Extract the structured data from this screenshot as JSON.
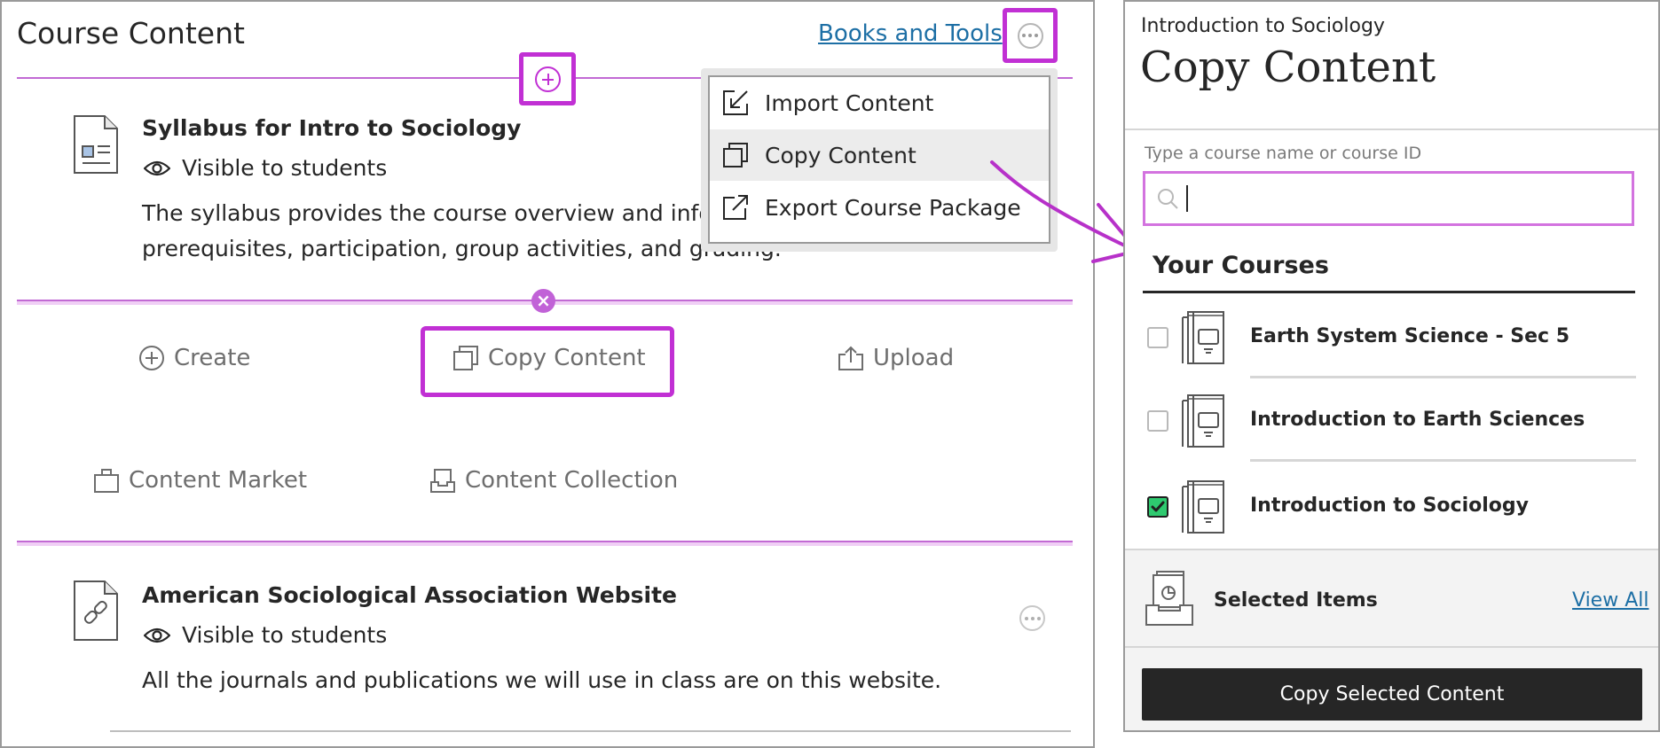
{
  "course_content": {
    "title": "Course Content",
    "books_link": "Books and Tools",
    "items": [
      {
        "title": "Syllabus for Intro to Sociology",
        "visibility": "Visible to students",
        "description": "The syllabus provides the course overview and inform",
        "description_line2": "prerequisites, participation, group activities, and grading."
      },
      {
        "title": "American Sociological Association Website",
        "visibility": "Visible to students",
        "description": "All the journals and publications we will use in class are on this website."
      }
    ],
    "actions": {
      "create": "Create",
      "copy_content": "Copy Content",
      "upload": "Upload",
      "content_market": "Content Market",
      "content_collection": "Content Collection"
    },
    "menu": [
      "Import Content",
      "Copy Content",
      "Export Course Package"
    ]
  },
  "copy_panel": {
    "breadcrumb": "Introduction to Sociology",
    "title": "Copy Content",
    "search_label": "Type a course name or course ID",
    "search_value": "",
    "your_courses_heading": "Your Courses",
    "courses": [
      {
        "name": "Earth System Science - Sec 5",
        "checked": false
      },
      {
        "name": "Introduction to Earth Sciences",
        "checked": false
      },
      {
        "name": "Introduction to Sociology",
        "checked": true
      }
    ],
    "selected_items_label": "Selected Items",
    "view_all_link": "View All",
    "copy_button": "Copy Selected Content"
  },
  "colors": {
    "highlight": "#c130d4",
    "link": "#1d6fa5",
    "checked": "#2ec96f",
    "primary_button": "#262626"
  }
}
